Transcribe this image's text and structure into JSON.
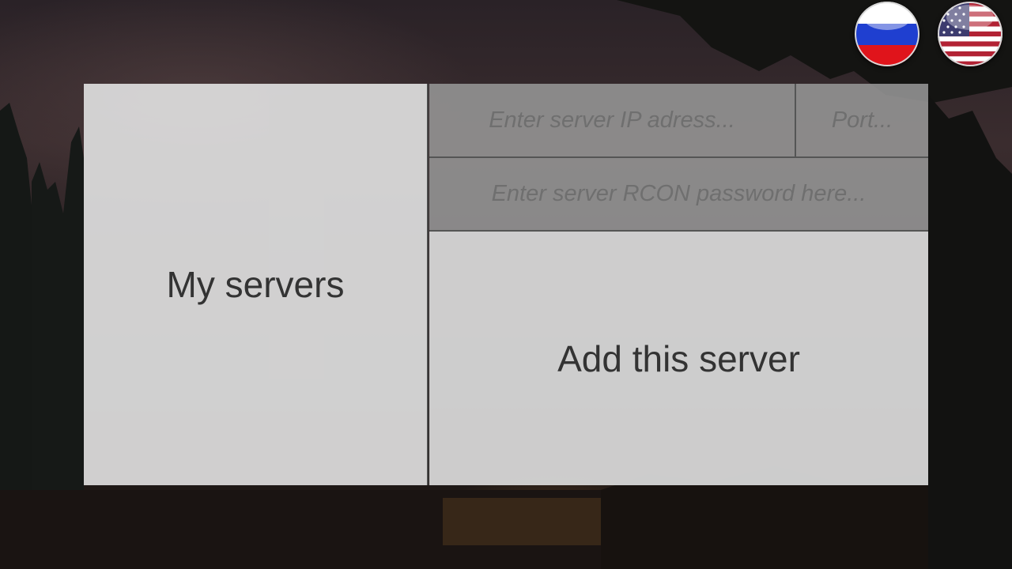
{
  "language_switcher": {
    "options": [
      {
        "code": "ru",
        "icon": "russia-flag-icon",
        "colors": [
          "#ffffff",
          "#1f3fd0",
          "#e0141b"
        ]
      },
      {
        "code": "en",
        "icon": "usa-flag-icon",
        "colors": [
          "#b22234",
          "#ffffff",
          "#3c3b6e"
        ]
      }
    ]
  },
  "panel": {
    "my_servers_label": "My servers",
    "ip_placeholder": "Enter server IP adress...",
    "port_placeholder": "Port...",
    "rcon_placeholder": "Enter server RCON password here...",
    "add_server_label": "Add this server"
  },
  "colors": {
    "panel_light": "#dedede",
    "panel_field": "#969696",
    "label_text": "#333333",
    "placeholder_text": "#6f6f6f"
  }
}
